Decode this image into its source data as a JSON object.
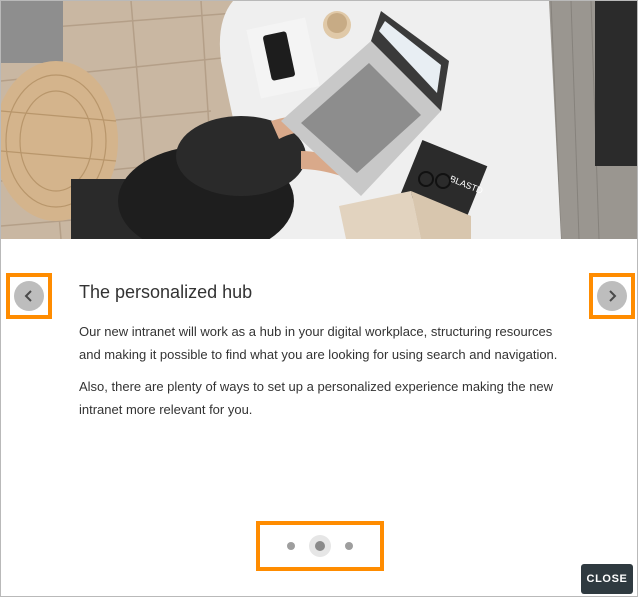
{
  "hero": {
    "laptop_sticker_text": "BLASTD"
  },
  "content": {
    "title": "The personalized hub",
    "paragraph_1_line_1": "Our new intranet will work as a hub in your digital workplace, structuring resources",
    "paragraph_1_line_2": "and making it possible to find what you are looking for using search and navigation.",
    "paragraph_2_line_1": "Also, there are plenty of ways to set up a personalized experience making the new",
    "paragraph_2_line_2": "intranet more relevant for you."
  },
  "navigation": {
    "prev_icon": "chevron-left-icon",
    "next_icon": "chevron-right-icon",
    "current_slide": 2,
    "total_slides": 3
  },
  "footer": {
    "close_label": "CLOSE"
  },
  "colors": {
    "highlight": "#ff8c00",
    "close_button": "#2f3a40",
    "arrow_bg": "#bdbdbd"
  }
}
